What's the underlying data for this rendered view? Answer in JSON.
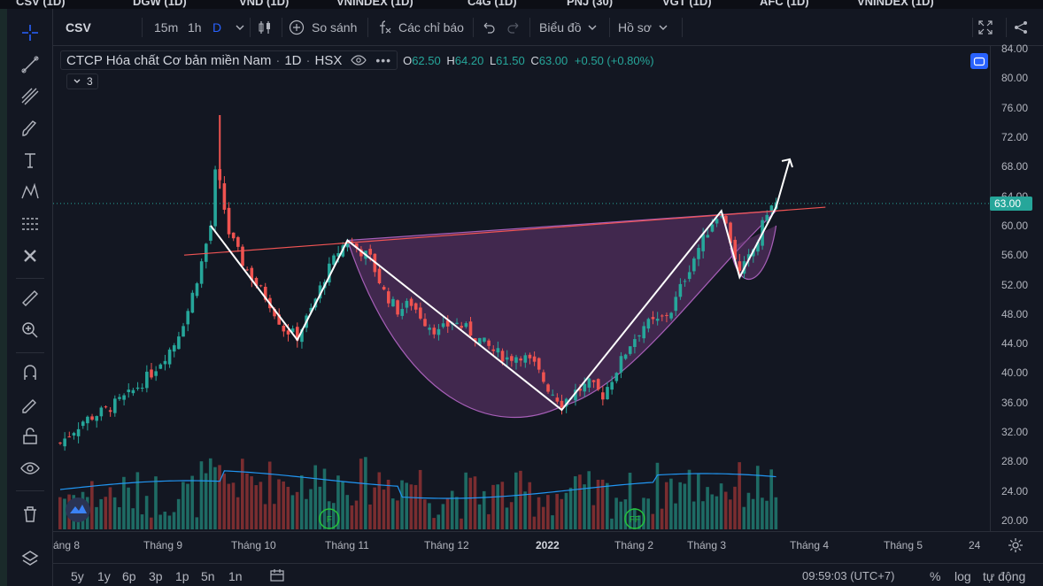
{
  "tabs": [
    {
      "label": "CSV (1D)"
    },
    {
      "label": "DGW (1D)"
    },
    {
      "label": "VND (1D)"
    },
    {
      "label": "VNINDEX (1D)"
    },
    {
      "label": "C4G (1D)"
    },
    {
      "label": "PNJ (30)"
    },
    {
      "label": "VGT (1D)"
    },
    {
      "label": "AFC (1D)"
    },
    {
      "label": "VNINDEX (1D)"
    }
  ],
  "topbar": {
    "symbol": "CSV",
    "intervals": [
      "15m",
      "1h",
      "D"
    ],
    "active_interval": "D",
    "compare_label": "So sánh",
    "indicators_label": "Các chỉ báo",
    "chart_type_label": "Biểu đồ",
    "profile_label": "Hồ sơ"
  },
  "legend": {
    "title": "CTCP Hóa chất Cơ bản miền Nam",
    "interval": "1D",
    "exchange": "HSX",
    "open_label": "O",
    "open": "62.50",
    "high_label": "H",
    "high": "64.20",
    "low_label": "L",
    "low": "61.50",
    "close_label": "C",
    "close": "63.00",
    "change": "+0.50 (+0.80%)",
    "indicator_count": "3"
  },
  "price_axis": {
    "ticks": [
      "84.00",
      "80.00",
      "76.00",
      "72.00",
      "68.00",
      "64.00",
      "60.00",
      "56.00",
      "52.00",
      "48.00",
      "44.00",
      "40.00",
      "36.00",
      "32.00",
      "28.00",
      "24.00",
      "20.00"
    ],
    "last_price": "63.00"
  },
  "time_axis": {
    "ticks": [
      "áng 8",
      "Tháng 9",
      "Tháng 10",
      "Tháng 11",
      "Tháng 12",
      "2022",
      "Tháng 2",
      "Tháng 3",
      "Tháng 4",
      "Tháng 5",
      "24"
    ]
  },
  "bottombar": {
    "ranges": [
      "5y",
      "1y",
      "6p",
      "3p",
      "1p",
      "5n",
      "1n"
    ],
    "clock": "09:59:03 (UTC+7)",
    "percent": "%",
    "log": "log",
    "auto": "tự động"
  },
  "markers": [
    "F",
    "FF"
  ],
  "colors": {
    "up": "#26a69a",
    "down": "#ef5350",
    "volume_up": "#1e6b64",
    "volume_down": "#7a2d30",
    "ma_line": "#2196f3",
    "resistance": "#f05454",
    "zigzag": "#ffffff",
    "cup_fill": "#7b3f86",
    "background": "#131722"
  },
  "chart_data": {
    "type": "candlestick",
    "symbol": "CSV",
    "interval": "1D",
    "ylim": [
      20,
      84
    ],
    "last_close": 63.0,
    "price_path": [
      [
        0,
        30.5
      ],
      [
        5,
        33.5
      ],
      [
        10,
        35.0
      ],
      [
        15,
        37.0
      ],
      [
        20,
        40.0
      ],
      [
        25,
        44.0
      ],
      [
        28,
        48.5
      ],
      [
        31,
        55.0
      ],
      [
        33,
        60.0
      ],
      [
        34,
        67.0
      ],
      [
        35,
        65.5
      ],
      [
        37,
        59.0
      ],
      [
        40,
        55.0
      ],
      [
        43,
        52.0
      ],
      [
        46,
        49.5
      ],
      [
        49,
        46.0
      ],
      [
        52,
        45.0
      ],
      [
        55,
        48.5
      ],
      [
        58,
        53.0
      ],
      [
        61,
        56.5
      ],
      [
        63,
        58.0
      ],
      [
        65,
        57.0
      ],
      [
        68,
        55.5
      ],
      [
        71,
        51.0
      ],
      [
        74,
        48.5
      ],
      [
        77,
        49.5
      ],
      [
        80,
        47.0
      ],
      [
        83,
        45.5
      ],
      [
        86,
        47.0
      ],
      [
        89,
        46.0
      ],
      [
        92,
        44.5
      ],
      [
        95,
        43.0
      ],
      [
        98,
        42.0
      ],
      [
        101,
        42.5
      ],
      [
        104,
        41.0
      ],
      [
        107,
        38.0
      ],
      [
        110,
        36.0
      ],
      [
        113,
        37.5
      ],
      [
        116,
        38.5
      ],
      [
        119,
        37.0
      ],
      [
        122,
        40.5
      ],
      [
        125,
        44.0
      ],
      [
        128,
        46.5
      ],
      [
        131,
        47.0
      ],
      [
        134,
        48.5
      ],
      [
        137,
        53.0
      ],
      [
        140,
        57.0
      ],
      [
        143,
        60.5
      ],
      [
        145,
        62.0
      ],
      [
        147,
        58.0
      ],
      [
        149,
        53.5
      ],
      [
        151,
        55.5
      ],
      [
        153,
        58.0
      ],
      [
        155,
        62.0
      ],
      [
        157,
        63.0
      ]
    ],
    "annotations": {
      "resistance_line": [
        [
          0,
          56.0
        ],
        [
          162,
          62.5
        ]
      ],
      "zigzag": [
        [
          33,
          60.0
        ],
        [
          52,
          44.5
        ],
        [
          63,
          58.0
        ],
        [
          110,
          35.0
        ],
        [
          145,
          62.0
        ],
        [
          149,
          53.0
        ],
        [
          157,
          62.5
        ],
        [
          160,
          69.0
        ]
      ],
      "cup": "rounded bottom between Tháng 11 and Tháng 3"
    }
  }
}
